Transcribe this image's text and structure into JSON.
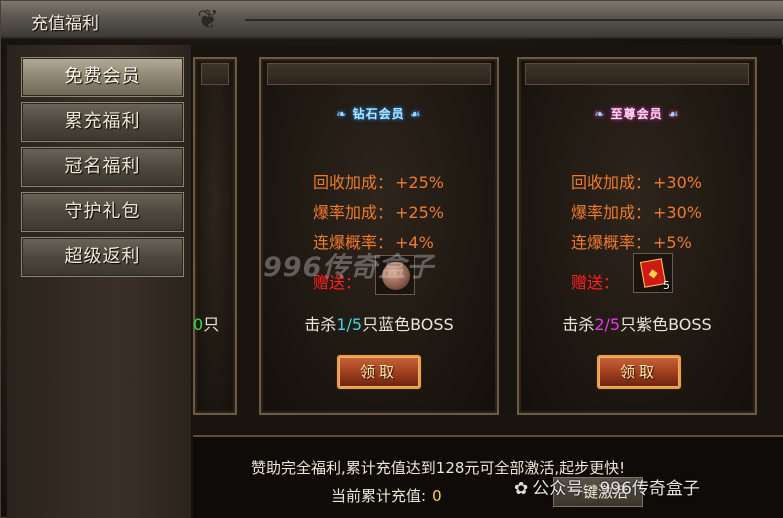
{
  "window": {
    "title": "充值福利"
  },
  "sidebar": {
    "tabs": [
      {
        "label": "免费会员",
        "active": true
      },
      {
        "label": "累充福利",
        "active": false
      },
      {
        "label": "冠名福利",
        "active": false
      },
      {
        "label": "守护礼包",
        "active": false
      },
      {
        "label": "超级返利",
        "active": false
      }
    ]
  },
  "cards": {
    "partial": {
      "progress": "0",
      "unit": "只"
    },
    "diamond": {
      "badge": "钻石会员",
      "stats": [
        {
          "label": "回收加成：",
          "value": "+25%"
        },
        {
          "label": "爆率加成：",
          "value": "+25%"
        },
        {
          "label": "连爆概率：",
          "value": "+4%"
        }
      ],
      "gift_label": "赠送：",
      "gift_icon": "orb-icon",
      "task_prefix": "击杀",
      "task_progress": "1/5",
      "task_suffix": "只蓝色BOSS",
      "claim_label": "领取"
    },
    "supreme": {
      "badge": "至尊会员",
      "stats": [
        {
          "label": "回收加成：",
          "value": "+30%"
        },
        {
          "label": "爆率加成：",
          "value": "+30%"
        },
        {
          "label": "连爆概率：",
          "value": "+5%"
        }
      ],
      "gift_label": "赠送：",
      "gift_icon": "red-gift-box-icon",
      "gift_count": "5",
      "task_prefix": "击杀",
      "task_progress": "2/5",
      "task_suffix": "只紫色BOSS",
      "claim_label": "领取"
    }
  },
  "footer": {
    "note": "赞助完全福利,累计充值达到128元可全部激活,起步更快!",
    "current_label": "当前累计充值:",
    "current_amount": "0",
    "activate_label": "一键激活"
  },
  "watermarks": {
    "logo": "996传奇盒子",
    "wechat": "公众号 · 996传奇盒子"
  },
  "colors": {
    "stat_orange": "#ef7a2c",
    "gift_red": "#ff2020",
    "progress_cyan": "#3ad6e6",
    "progress_magenta": "#e23ae6",
    "amount_yellow": "#ffd53a",
    "progress_green": "#30e040"
  }
}
